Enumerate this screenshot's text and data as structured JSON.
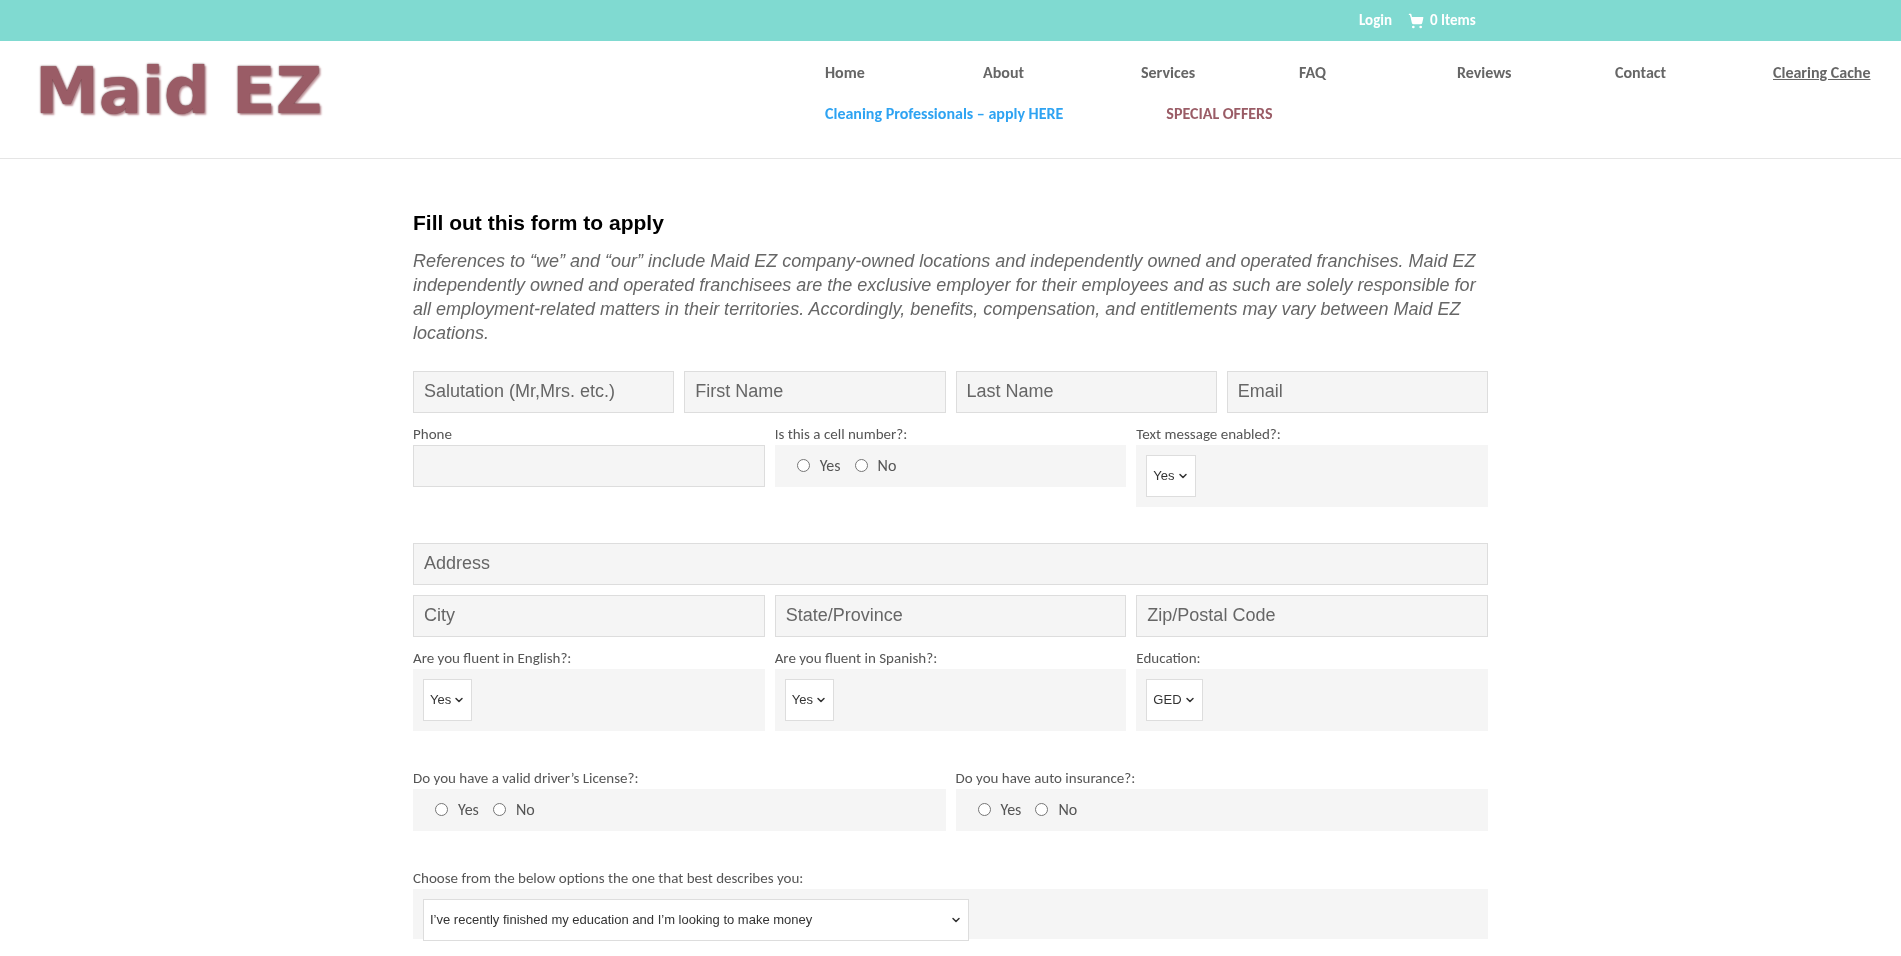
{
  "top_bar": {
    "login": "Login",
    "cart": "0 Items"
  },
  "header": {
    "logo": "Maid EZ",
    "nav": [
      {
        "label": "Home",
        "kind": "plain"
      },
      {
        "label": "About",
        "kind": "plain"
      },
      {
        "label": "Services",
        "kind": "plain"
      },
      {
        "label": "FAQ",
        "kind": "plain"
      },
      {
        "label": "Reviews",
        "kind": "plain"
      },
      {
        "label": "Contact",
        "kind": "plain"
      },
      {
        "label": "Clearing Cache",
        "kind": "underlined"
      }
    ],
    "nav_secondary": [
      {
        "label": "Cleaning Professionals – apply HERE",
        "color": "#2ea3f2"
      },
      {
        "label": "SPECIAL OFFERS",
        "color": "#9a5c66"
      }
    ]
  },
  "form": {
    "title": "Fill out this form to apply",
    "intro": "References to “we” and “our” include Maid EZ company-owned locations and independently owned and operated franchises. Maid EZ independently owned and operated franchisees are the exclusive employer for their employees and as such are solely responsible for all employment-related matters in their territories. Accordingly, benefits, compensation, and entitlements may vary between Maid EZ locations.",
    "rows": [
      {
        "fields": [
          {
            "kind": "text",
            "placeholder": "Salutation (Mr,Mrs. etc.)"
          },
          {
            "kind": "text",
            "placeholder": "First Name"
          },
          {
            "kind": "text",
            "placeholder": "Last Name"
          },
          {
            "kind": "text",
            "placeholder": "Email"
          }
        ]
      },
      {
        "fields": [
          {
            "kind": "labeled_text",
            "label": "Phone"
          },
          {
            "kind": "radio",
            "label": "Is this a cell number?:",
            "options": [
              {
                "label": "Yes",
                "selected": false
              },
              {
                "label": "No",
                "selected": false
              }
            ]
          },
          {
            "kind": "select",
            "label": "Text message enabled?:",
            "value": "Yes"
          }
        ]
      },
      {
        "fields": [
          {
            "kind": "text",
            "placeholder": "Address"
          }
        ]
      },
      {
        "fields": [
          {
            "kind": "text",
            "placeholder": "City"
          },
          {
            "kind": "text",
            "placeholder": "State/Province"
          },
          {
            "kind": "text",
            "placeholder": "Zip/Postal Code"
          }
        ]
      },
      {
        "fields": [
          {
            "kind": "select",
            "label": "Are you fluent in English?:",
            "value": "Yes"
          },
          {
            "kind": "select",
            "label": "Are you fluent in Spanish?:",
            "value": "Yes"
          },
          {
            "kind": "select",
            "label": "Education:",
            "value": "GED"
          }
        ]
      },
      {
        "fields": [
          {
            "kind": "radio",
            "label": "Do you have a valid driver’s License?:",
            "options": [
              {
                "label": "Yes",
                "selected": false
              },
              {
                "label": "No",
                "selected": false
              }
            ]
          },
          {
            "kind": "radio",
            "label": "Do you have auto insurance?:",
            "options": [
              {
                "label": "Yes",
                "selected": false
              },
              {
                "label": "No",
                "selected": false
              }
            ]
          }
        ]
      },
      {
        "fields": [
          {
            "kind": "select",
            "label": "Choose from the below options the one that best describes you:",
            "value": "I’ve recently finished my education and I’m looking to make money"
          }
        ]
      }
    ]
  }
}
